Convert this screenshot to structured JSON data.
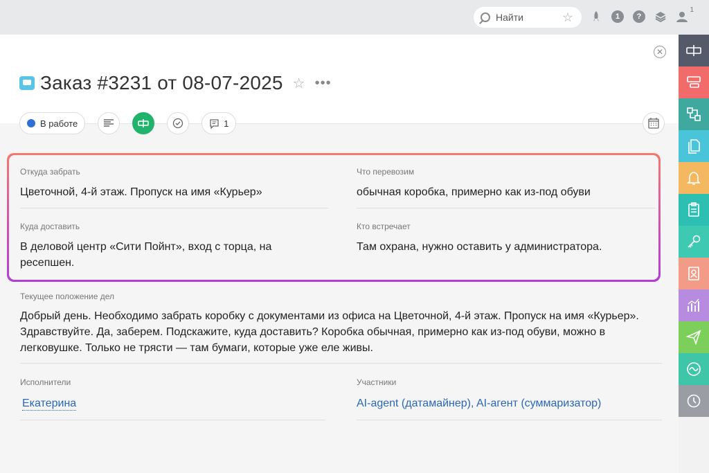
{
  "topbar": {
    "search_placeholder": "Найти",
    "notification_count": "1"
  },
  "task": {
    "title": "Заказ #3231 от 08-07-2025",
    "status": "В работе",
    "comments_count": "1"
  },
  "fields": {
    "pickup_label": "Откуда забрать",
    "pickup_value": "Цветочной, 4-й этаж. Пропуск на имя «Курьер»",
    "cargo_label": "Что перевозим",
    "cargo_value": "обычная коробка, примерно как из-под обуви",
    "delivery_label": "Куда доставить",
    "delivery_value": "В деловой центр «Сити Пойнт», вход с торца, на ресепшен.",
    "receiver_label": "Кто встречает",
    "receiver_value": "Там охрана, нужно оставить у администратора."
  },
  "status_section": {
    "label": "Текущее положение дел",
    "text": "Добрый день. Необходимо забрать коробку с документами из офиса на Цветочной, 4-й этаж. Пропуск на имя «Курьер». Здравствуйте. Да, заберем. Подскажите, куда доставить? Коробка обычная, примерно как из-под обуви, можно в легковушке. Только не трясти — там бумаги, которые уже еле живы."
  },
  "people": {
    "executors_label": "Исполнители",
    "executor": "Екатерина",
    "participants_label": "Участники",
    "participant_1": "AI-agent (датамайнер)",
    "separator": ", ",
    "participant_2": "AI-агент (суммаризатор)"
  },
  "rail_colors": [
    "#555a6b",
    "#f26b6b",
    "#3fa9a0",
    "#49c4d8",
    "#f4b860",
    "#2cbfb2",
    "#3ec9b3",
    "#f29b86",
    "#b68be0",
    "#7ccf5a",
    "#3fc5a8",
    "#9a9da3",
    "#eb8fa8"
  ]
}
